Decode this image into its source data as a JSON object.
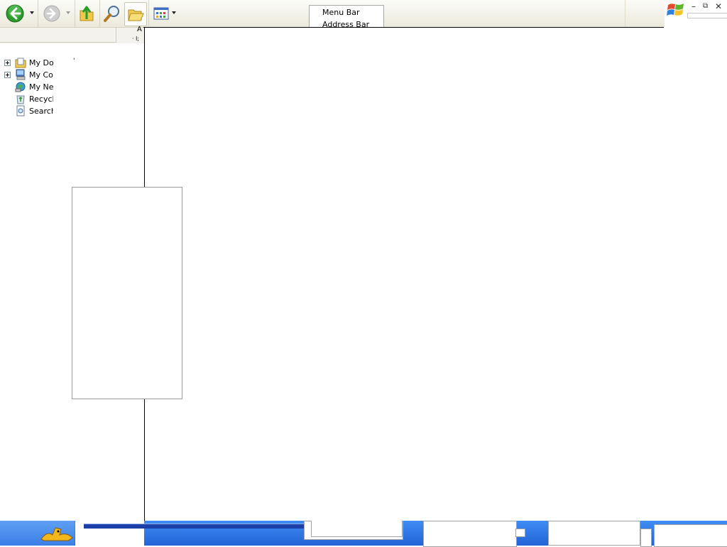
{
  "toolbar": {
    "buttons": [
      {
        "name": "back",
        "icon": "back-arrow-icon"
      },
      {
        "name": "forward",
        "icon": "forward-arrow-icon"
      },
      {
        "name": "up",
        "icon": "folder-up-icon"
      },
      {
        "name": "search",
        "icon": "search-icon"
      },
      {
        "name": "folders",
        "icon": "folders-icon"
      },
      {
        "name": "views",
        "icon": "views-icon"
      }
    ]
  },
  "popup_menu": {
    "items": [
      "Menu Bar",
      "Address Bar"
    ]
  },
  "header_fragments": [
    "A",
    "· l;"
  ],
  "tree": {
    "items": [
      {
        "label": "My Dor",
        "expandable": true,
        "icon": "my-documents-icon"
      },
      {
        "label": "My Co",
        "expandable": true,
        "icon": "my-computer-icon"
      },
      {
        "label": "My Ne",
        "expandable": false,
        "icon": "my-network-icon"
      },
      {
        "label": "Recycl",
        "expandable": false,
        "icon": "recycle-bin-icon"
      },
      {
        "label": "Search",
        "expandable": false,
        "icon": "search-results-icon"
      }
    ]
  },
  "colors": {
    "toolbar_bg": "#eceadb",
    "taskbar_blue": "#2363d6",
    "back_green": "#2b9b2b"
  }
}
